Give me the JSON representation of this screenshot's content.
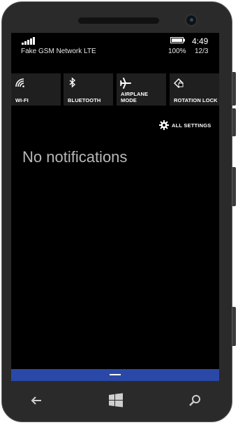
{
  "status_bar": {
    "carrier": "Fake GSM Network LTE",
    "battery_percent": "100%",
    "time": "4:49",
    "date": "12/3"
  },
  "quick_actions": [
    {
      "label": "WI-FI",
      "icon": "wifi-icon"
    },
    {
      "label": "BLUETOOTH",
      "icon": "bluetooth-icon"
    },
    {
      "label": "AIRPLANE\nMODE",
      "icon": "airplane-icon"
    },
    {
      "label": "ROTATION LOCK",
      "icon": "rotation-lock-icon"
    }
  ],
  "all_settings_label": "ALL SETTINGS",
  "notifications_message": "No notifications",
  "nav_buttons": [
    "back-icon",
    "windows-start-icon",
    "search-icon"
  ],
  "colors": {
    "accent": "#2a48a8",
    "screen_bg": "#000000",
    "tile_bg": "#1f1f1f",
    "phone_body": "#2a2a2a"
  }
}
